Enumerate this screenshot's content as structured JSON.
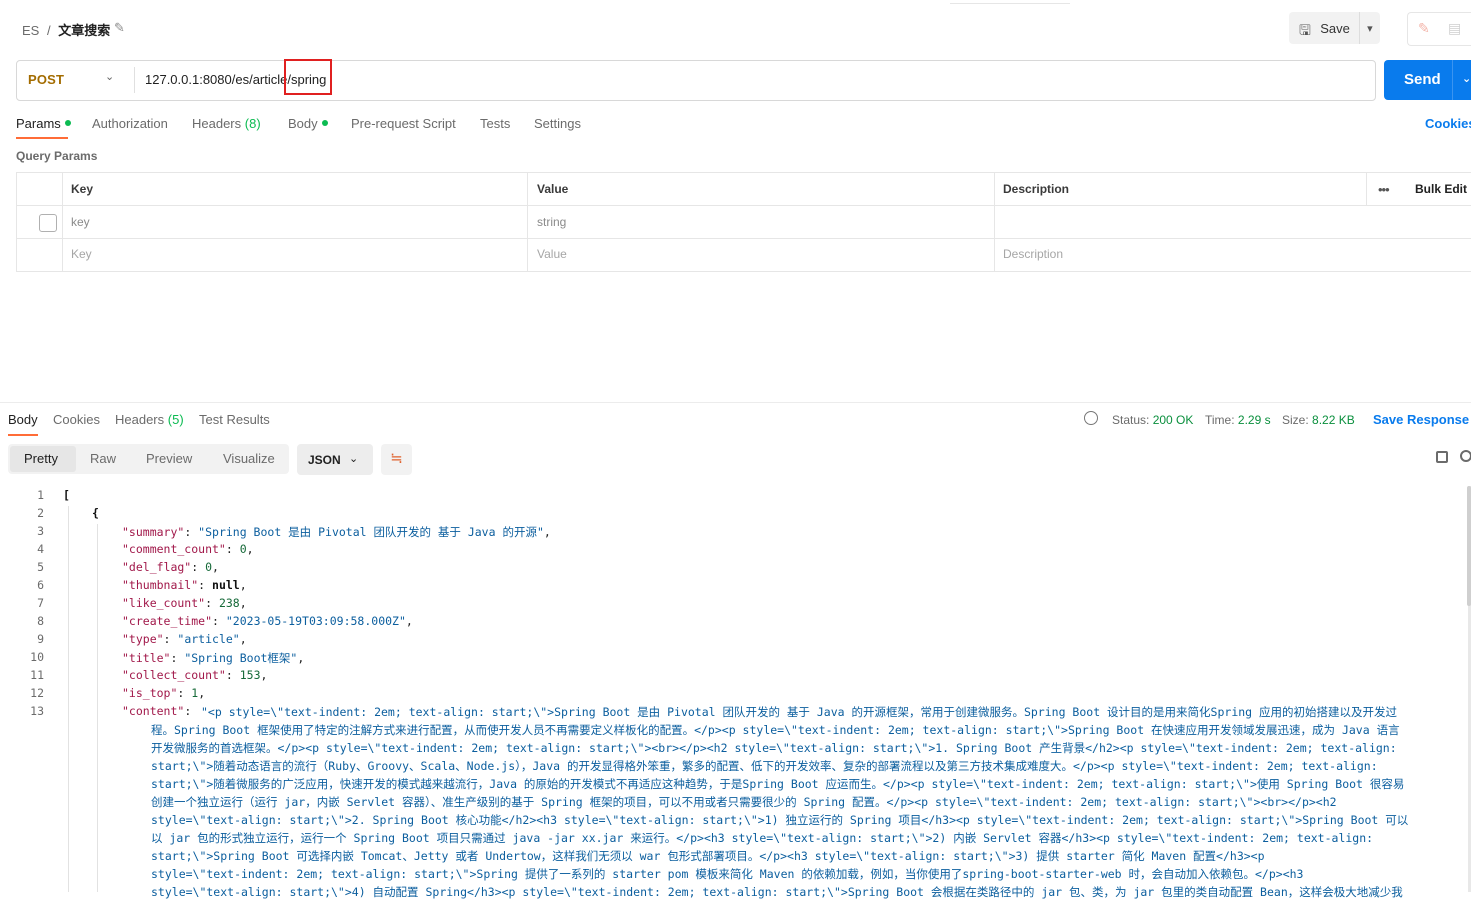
{
  "header": {
    "breadcrumb_parent": "ES",
    "breadcrumb_sep": "/",
    "breadcrumb_current": "文章搜索",
    "save_label": "Save"
  },
  "request": {
    "method": "POST",
    "url": "127.0.0.1:8080/es/article/spring",
    "send_label": "Send"
  },
  "request_tabs": {
    "params": "Params",
    "authorization": "Authorization",
    "headers": "Headers",
    "headers_count": "(8)",
    "body": "Body",
    "pre_request": "Pre-request Script",
    "tests": "Tests",
    "settings": "Settings",
    "cookies": "Cookies"
  },
  "query_params": {
    "title": "Query Params",
    "columns": {
      "key": "Key",
      "value": "Value",
      "description": "Description",
      "bulk_edit": "Bulk Edit"
    },
    "rows": [
      {
        "key": "key",
        "value": "string",
        "description": ""
      }
    ],
    "placeholder": {
      "key": "Key",
      "value": "Value",
      "description": "Description"
    }
  },
  "response": {
    "tabs": {
      "body": "Body",
      "cookies": "Cookies",
      "headers": "Headers",
      "headers_count": "(5)",
      "test_results": "Test Results"
    },
    "status_label": "Status:",
    "status_value": "200 OK",
    "time_label": "Time:",
    "time_value": "2.29 s",
    "size_label": "Size:",
    "size_value": "8.22 KB",
    "save_response": "Save Response",
    "view_modes": {
      "pretty": "Pretty",
      "raw": "Raw",
      "preview": "Preview",
      "visualize": "Visualize"
    },
    "format": "JSON"
  },
  "code": {
    "line_numbers": [
      "1",
      "2",
      "3",
      "4",
      "5",
      "6",
      "7",
      "8",
      "9",
      "10",
      "11",
      "12",
      "13"
    ],
    "l1": "[",
    "l2": "{",
    "summary_key": "\"summary\"",
    "summary_val": "\"Spring Boot 是由 Pivotal 团队开发的 基于 Java 的开源\"",
    "comment_count_key": "\"comment_count\"",
    "comment_count_val": "0",
    "del_flag_key": "\"del_flag\"",
    "del_flag_val": "0",
    "thumbnail_key": "\"thumbnail\"",
    "thumbnail_val": "null",
    "like_count_key": "\"like_count\"",
    "like_count_val": "238",
    "create_time_key": "\"create_time\"",
    "create_time_val": "\"2023-05-19T03:09:58.000Z\"",
    "type_key": "\"type\"",
    "type_val": "\"article\"",
    "title_key": "\"title\"",
    "title_val": "\"Spring Boot框架\"",
    "collect_count_key": "\"collect_count\"",
    "collect_count_val": "153",
    "is_top_key": "\"is_top\"",
    "is_top_val": "1",
    "content_key": "\"content\"",
    "content_lines": [
      "\"<p style=\\\"text-indent: 2em; text-align: start;\\\">Spring Boot 是由 Pivotal 团队开发的 基于 Java 的开源框架，常用于创建微服务。Spring Boot 设计目的是用来简化Spring 应用的初始搭建以及开发过",
      "程。Spring Boot 框架使用了特定的注解方式来进行配置，从而使开发人员不再需要定义样板化的配置。</p><p style=\\\"text-indent: 2em; text-align: start;\\\">Spring Boot 在快速应用开发领域发展迅速，成为 Java 语言",
      "开发微服务的首选框架。</p><p style=\\\"text-indent: 2em; text-align: start;\\\"><br></p><h2 style=\\\"text-align: start;\\\">1. Spring Boot 产生背景</h2><p style=\\\"text-indent: 2em; text-align:",
      "start;\\\">随着动态语言的流行（Ruby、Groovy、Scala、Node.js），Java 的开发显得格外笨重，繁多的配置、低下的开发效率、复杂的部署流程以及第三方技术集成难度大。</p><p style=\\\"text-indent: 2em; text-align:",
      "start;\\\">随着微服务的广泛应用，快速开发的模式越来越流行，Java 的原始的开发模式不再适应这种趋势，于是Spring Boot 应运而生。</p><p style=\\\"text-indent: 2em; text-align: start;\\\">使用 Spring Boot 很容易",
      "创建一个独立运行（运行 jar，内嵌 Servlet 容器）、准生产级别的基于 Spring 框架的项目，可以不用或者只需要很少的 Spring 配置。</p><p style=\\\"text-indent: 2em; text-align: start;\\\"><br></p><h2",
      "style=\\\"text-align: start;\\\">2. Spring Boot 核心功能</h2><h3 style=\\\"text-align: start;\\\">1) 独立运行的 Spring 项目</h3><p style=\\\"text-indent: 2em; text-align: start;\\\">Spring Boot 可以",
      "以 jar 包的形式独立运行，运行一个 Spring Boot 项目只需通过 java -jar xx.jar 来运行。</p><h3 style=\\\"text-align: start;\\\">2) 内嵌 Servlet 容器</h3><p style=\\\"text-indent: 2em; text-align:",
      "start;\\\">Spring Boot 可选择内嵌 Tomcat、Jetty 或者 Undertow，这样我们无须以 war 包形式部署项目。</p><h3 style=\\\"text-align: start;\\\">3) 提供 starter 简化 Maven 配置</h3><p",
      "style=\\\"text-indent: 2em; text-align: start;\\\">Spring 提供了一系列的 starter pom 模板来简化 Maven 的依赖加载，例如，当你使用了spring-boot-starter-web 时，会自动加入依赖包。</p><h3",
      "style=\\\"text-align: start;\\\">4) 自动配置 Spring</h3><p style=\\\"text-indent: 2em; text-align: start;\\\">Spring Boot 会根据在类路径中的 jar 包、类，为 jar 包里的类自动配置 Bean，这样会极大地减少我"
    ]
  }
}
